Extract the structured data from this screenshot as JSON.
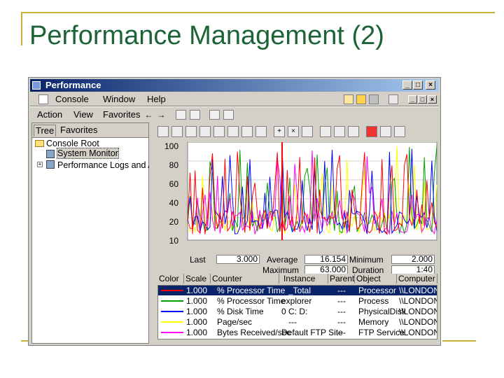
{
  "slide": {
    "title": "Performance Management (2)"
  },
  "window": {
    "title": "Performance",
    "controls": [
      "_",
      "□",
      "×"
    ],
    "menu": [
      "Console",
      "Window",
      "Help"
    ],
    "mdi_controls": [
      "_",
      "□",
      "×"
    ],
    "action_menu": [
      "Action",
      "View",
      "Favorites"
    ],
    "tabs": [
      "Tree",
      "Favorites"
    ],
    "tree": {
      "root": "Console Root",
      "children": [
        "System Monitor",
        "Performance Logs and Alerts"
      ]
    }
  },
  "graph": {
    "y_ticks": [
      "100",
      "80",
      "60",
      "40",
      "20",
      "10"
    ],
    "colors": {
      "red": "#ff0000",
      "green": "#00a000",
      "blue": "#0000ff",
      "yellow": "#ffff00",
      "magenta": "#ff00ff",
      "cursor": "#ff0000"
    }
  },
  "stats": {
    "last_label": "Last",
    "last_value": "3.000",
    "average_label": "Average",
    "average_value": "16.154",
    "minimum_label": "Minimum",
    "minimum_value": "2.000",
    "maximum_label": "Maximum",
    "maximum_value": "63.000",
    "duration_label": "Duration",
    "duration_value": "1:40"
  },
  "legend": {
    "headers": [
      "Color",
      "Scale",
      "Counter",
      "Instance",
      "Parent",
      "Object",
      "Computer"
    ],
    "rows": [
      {
        "color": "#ff0000",
        "scale": "1.000",
        "counter": "% Processor Time",
        "instance": "_Total",
        "parent": "---",
        "object": "Processor",
        "computer": "\\\\LONDON"
      },
      {
        "color": "#00a000",
        "scale": "1.000",
        "counter": "% Processor Time",
        "instance": "explorer",
        "parent": "---",
        "object": "Process",
        "computer": "\\\\LONDON"
      },
      {
        "color": "#0000ff",
        "scale": "1.000",
        "counter": "% Disk Time",
        "instance": "0 C: D:",
        "parent": "---",
        "object": "PhysicalDisk",
        "computer": "\\\\LONDON"
      },
      {
        "color": "#ffff00",
        "scale": "1.000",
        "counter": "Page/sec",
        "instance": "---",
        "parent": "---",
        "object": "Memory",
        "computer": "\\\\LONDON"
      },
      {
        "color": "#ff00ff",
        "scale": "1.000",
        "counter": "Bytes Received/sec",
        "instance": "Default FTP Site",
        "parent": "---",
        "object": "FTP Service",
        "computer": "\\\\LONDON"
      }
    ]
  }
}
